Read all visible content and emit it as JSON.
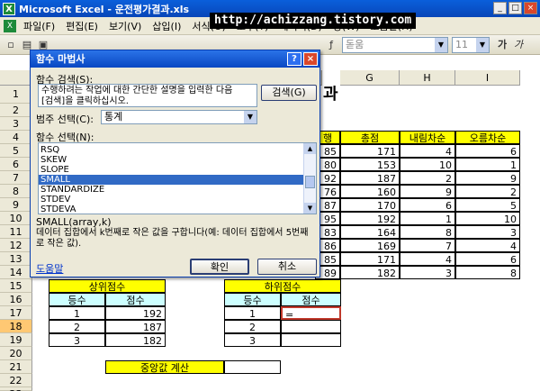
{
  "window": {
    "title": "Microsoft Excel - 운전평가결과.xls",
    "watermark": "http://achizzang.tistory.com",
    "minimize": "_",
    "maximize": "□",
    "close": "×"
  },
  "menu": [
    "파일(F)",
    "편집(E)",
    "보기(V)",
    "삽입(I)",
    "서식(O)",
    "도구(T)",
    "데이터(D)",
    "창(W)",
    "도움말(H)"
  ],
  "toolbar": {
    "font_name": "돋움",
    "font_size": "11"
  },
  "columns": [
    "G",
    "H",
    "I"
  ],
  "rows": [
    "1",
    "2",
    "3",
    "4",
    "5",
    "6",
    "7",
    "8",
    "9",
    "10",
    "11",
    "12",
    "13",
    "14",
    "15",
    "16",
    "17",
    "18",
    "19",
    "20",
    "21",
    "22",
    "23"
  ],
  "sheet": {
    "title_fragment": "과",
    "header_fragment": "행",
    "table_headers": [
      "총점",
      "내림차순",
      "오름차순"
    ],
    "f_values": [
      "85",
      "80",
      "92",
      "76",
      "87",
      "95",
      "83",
      "86",
      "85",
      "89"
    ],
    "g_values": [
      "171",
      "153",
      "187",
      "160",
      "170",
      "192",
      "164",
      "169",
      "171",
      "182"
    ],
    "h_values": [
      "4",
      "10",
      "2",
      "9",
      "6",
      "1",
      "8",
      "7",
      "4",
      "3"
    ],
    "i_values": [
      "6",
      "1",
      "9",
      "2",
      "5",
      "10",
      "3",
      "4",
      "6",
      "8"
    ],
    "top_title": "상위점수",
    "top_headers": [
      "등수",
      "점수"
    ],
    "top_ranks": [
      "1",
      "2",
      "3"
    ],
    "top_scores": [
      "192",
      "187",
      "182"
    ],
    "bottom_title": "하위점수",
    "bottom_headers": [
      "등수",
      "점수"
    ],
    "bottom_ranks": [
      "1",
      "2",
      "3"
    ],
    "bottom_formula": "=",
    "median_label": "중앙값 계산"
  },
  "dialog": {
    "title": "함수 마법사",
    "help_btn": "?",
    "close_btn": "×",
    "search_label": "함수 검색(S):",
    "search_text_line1": "수행하려는 작업에 대한 간단한 설명을 입력한 다음",
    "search_text_line2": "[검색]을 클릭하십시오.",
    "search_button": "검색(G)",
    "category_label": "범주 선택(C):",
    "category_value": "통계",
    "function_label": "함수 선택(N):",
    "functions": [
      "RSQ",
      "SKEW",
      "SLOPE",
      "SMALL",
      "STANDARDIZE",
      "STDEV",
      "STDEVA"
    ],
    "selected_function": "SMALL",
    "signature": "SMALL(array,k)",
    "description": "데이터 집합에서 k번째로 작은 값을 구합니다(예: 데이터 집합에서 5번째로 작은 값).",
    "help_link": "도움말",
    "ok_button": "확인",
    "cancel_button": "취소"
  },
  "colors": {
    "yellow": "#ffff00",
    "blue_header": "#ccffff",
    "selection": "#316ac5"
  }
}
